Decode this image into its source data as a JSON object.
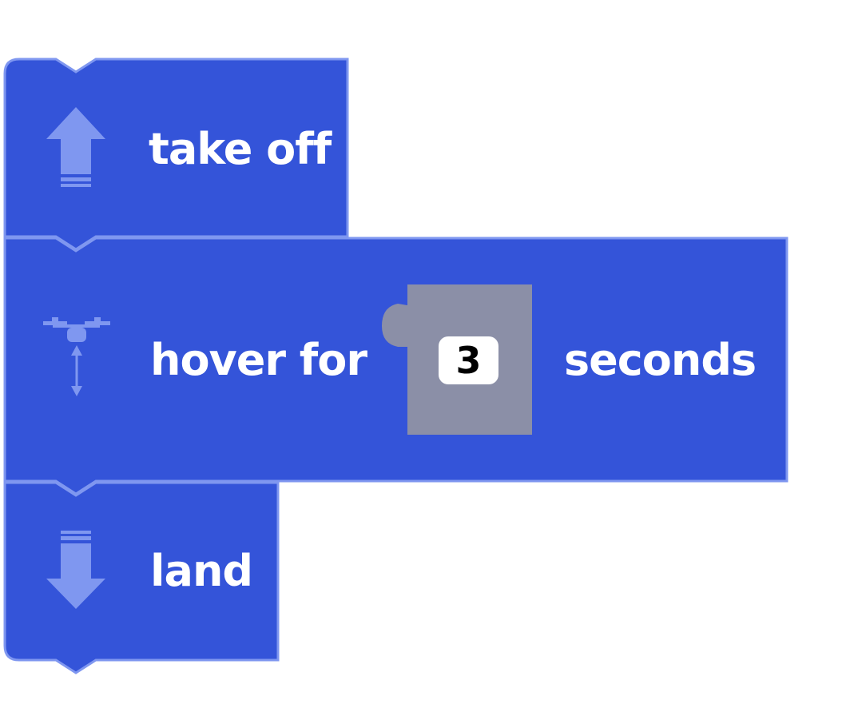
{
  "blocks": {
    "take_off": {
      "label": "take off",
      "icon": "arrow-up-icon"
    },
    "hover": {
      "label_before": "hover for",
      "seconds_value": "3",
      "label_after": "seconds",
      "icon": "drone-hover-icon"
    },
    "land": {
      "label": "land",
      "icon": "arrow-down-icon"
    }
  },
  "colors": {
    "block": "#3454d9",
    "block_border": "#7f97f0",
    "icon": "#7f97f0",
    "slot": "#8b8fa7",
    "background": "#ffffff"
  }
}
